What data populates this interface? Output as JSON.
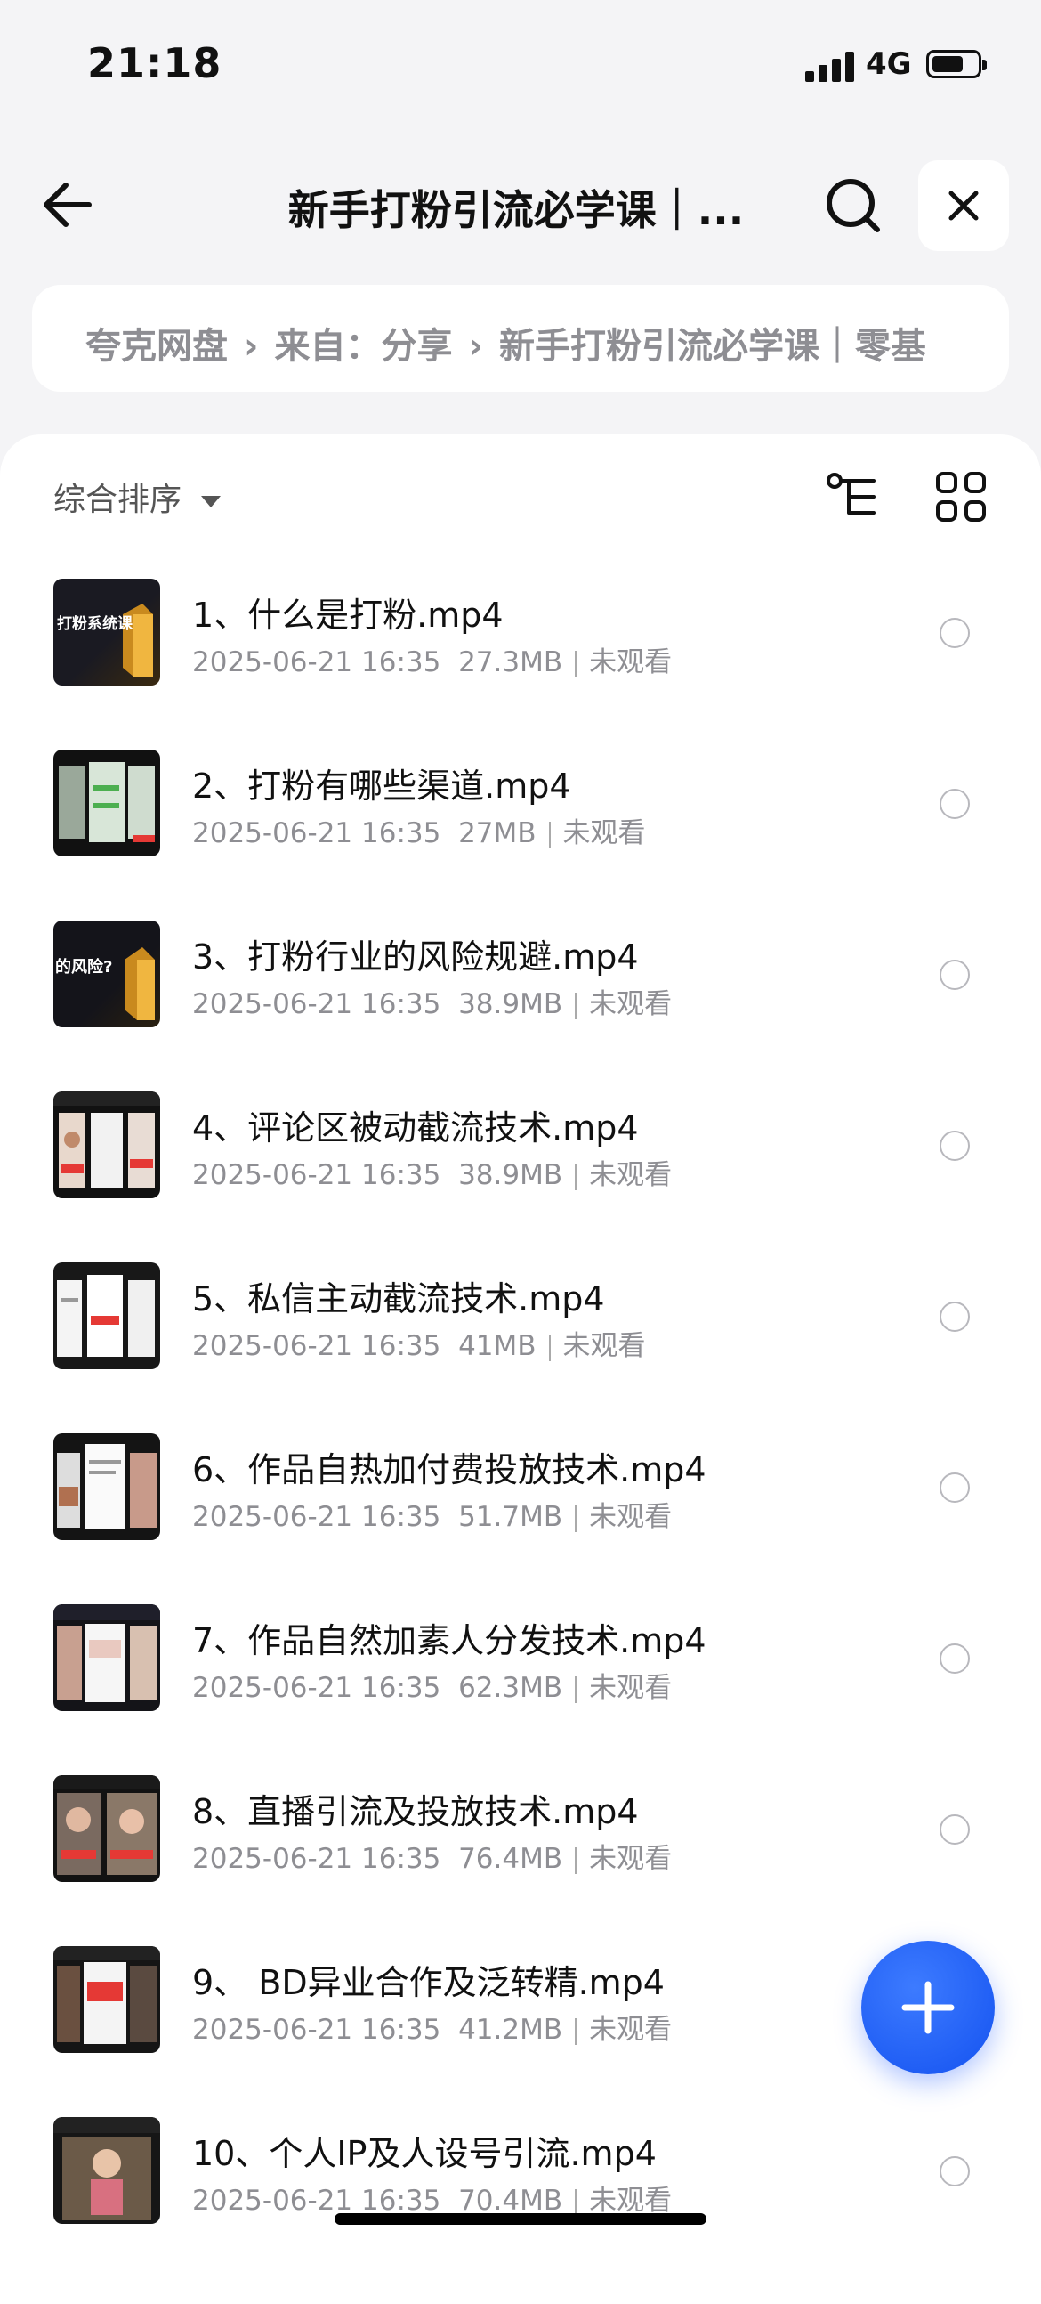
{
  "status": {
    "time": "21:18",
    "network": "4G"
  },
  "header": {
    "title": "新手打粉引流必学课｜..."
  },
  "breadcrumb": {
    "items": [
      "夸克网盘",
      "来自：分享",
      "新手打粉引流必学课｜零基"
    ]
  },
  "toolbar": {
    "sort_label": "综合排序"
  },
  "files": [
    {
      "name": "1、什么是打粉.mp4",
      "date": "2025-06-21 16:35",
      "size": "27.3MB",
      "status": "未观看",
      "thumb_text": "打粉系统课"
    },
    {
      "name": "2、打粉有哪些渠道.mp4",
      "date": "2025-06-21 16:35",
      "size": "27MB",
      "status": "未观看"
    },
    {
      "name": "3、打粉行业的风险规避.mp4",
      "date": "2025-06-21 16:35",
      "size": "38.9MB",
      "status": "未观看",
      "thumb_text": "的风险?"
    },
    {
      "name": "4、评论区被动截流技术.mp4",
      "date": "2025-06-21 16:35",
      "size": "38.9MB",
      "status": "未观看"
    },
    {
      "name": "5、私信主动截流技术.mp4",
      "date": "2025-06-21 16:35",
      "size": "41MB",
      "status": "未观看"
    },
    {
      "name": "6、作品自热加付费投放技术.mp4",
      "date": "2025-06-21 16:35",
      "size": "51.7MB",
      "status": "未观看"
    },
    {
      "name": "7、作品自然加素人分发技术.mp4",
      "date": "2025-06-21 16:35",
      "size": "62.3MB",
      "status": "未观看"
    },
    {
      "name": "8、直播引流及投放技术.mp4",
      "date": "2025-06-21 16:35",
      "size": "76.4MB",
      "status": "未观看"
    },
    {
      "name": "9、 BD异业合作及泛转精.mp4",
      "date": "2025-06-21 16:35",
      "size": "41.2MB",
      "status": "未观看"
    },
    {
      "name": "10、个人IP及人设号引流.mp4",
      "date": "2025-06-21 16:35",
      "size": "70.4MB",
      "status": "未观看"
    }
  ],
  "colors": {
    "accent": "#1452f0",
    "background": "#f4f4f6",
    "muted": "#8e8e93"
  }
}
